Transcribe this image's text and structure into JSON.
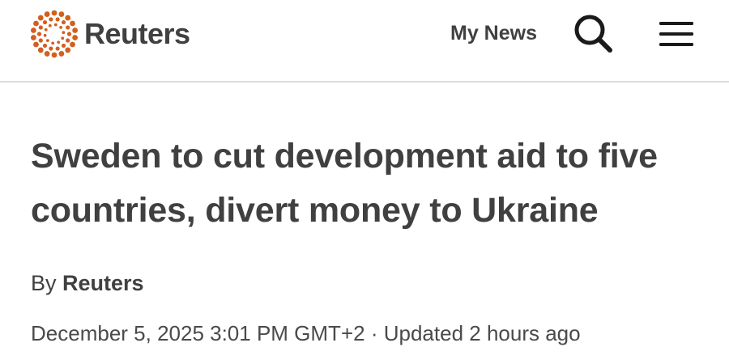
{
  "header": {
    "logo_text": "Reuters",
    "my_news_label": "My News",
    "search_icon": "search-icon",
    "menu_icon": "hamburger-menu-icon",
    "brand_color": "#d25f1e"
  },
  "article": {
    "headline": "Sweden to cut development aid to five countries, divert money to Ukraine",
    "byline_prefix": "By",
    "byline_author": "Reuters",
    "published": "December 5, 2025 3:01 PM GMT+2",
    "separator": "·",
    "updated": "Updated 2 hours ago"
  }
}
